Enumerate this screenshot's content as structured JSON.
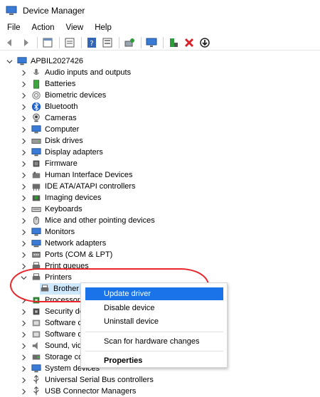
{
  "window": {
    "title": "Device Manager"
  },
  "menu": [
    "File",
    "Action",
    "View",
    "Help"
  ],
  "toolbar": {
    "icons": [
      "back-icon",
      "forward-icon",
      "properties-icon",
      "show-hidden-icon",
      "help-icon",
      "devices-by-type-icon",
      "scan-hardware-icon",
      "add-driver-icon",
      "uninstall-icon",
      "update-driver-icon"
    ]
  },
  "tree": {
    "root": "APBIL2027426",
    "items": [
      "Audio inputs and outputs",
      "Batteries",
      "Biometric devices",
      "Bluetooth",
      "Cameras",
      "Computer",
      "Disk drives",
      "Display adapters",
      "Firmware",
      "Human Interface Devices",
      "IDE ATA/ATAPI controllers",
      "Imaging devices",
      "Keyboards",
      "Mice and other pointing devices",
      "Monitors",
      "Network adapters",
      "Ports (COM & LPT)",
      "Print queues",
      "Printers",
      "Brother",
      "Processors",
      "Security dev",
      "Software co",
      "Software de",
      "Sound, vide",
      "Storage cor",
      "System devices",
      "Universal Serial Bus controllers",
      "USB Connector Managers"
    ]
  },
  "context_menu": {
    "update": "Update driver",
    "disable": "Disable device",
    "uninstall": "Uninstall device",
    "scan": "Scan for hardware changes",
    "properties": "Properties"
  },
  "colors": {
    "accent": "#1a73e8",
    "annotation": "#e8262b",
    "selection": "#cde8ff"
  }
}
